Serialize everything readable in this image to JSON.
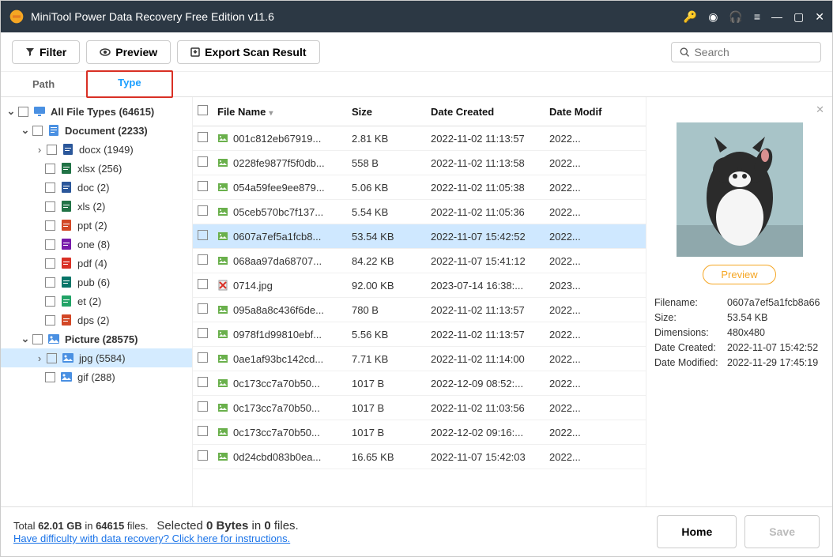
{
  "window": {
    "title": "MiniTool Power Data Recovery Free Edition v11.6"
  },
  "toolbar": {
    "filter": "Filter",
    "preview": "Preview",
    "export": "Export Scan Result",
    "searchPlaceholder": "Search"
  },
  "tabs": {
    "path": "Path",
    "type": "Type"
  },
  "tree": {
    "root": "All File Types (64615)",
    "document": "Document (2233)",
    "items": [
      "docx (1949)",
      "xlsx (256)",
      "doc (2)",
      "xls (2)",
      "ppt (2)",
      "one (8)",
      "pdf (4)",
      "pub (6)",
      "et (2)",
      "dps (2)"
    ],
    "picture": "Picture (28575)",
    "pic_items": [
      "jpg (5584)",
      "gif (288)"
    ]
  },
  "columns": {
    "name": "File Name",
    "size": "Size",
    "created": "Date Created",
    "modified": "Date Modif"
  },
  "rows": [
    {
      "name": "001c812eb67919...",
      "size": "2.81 KB",
      "created": "2022-11-02 11:13:57",
      "modified": "2022..."
    },
    {
      "name": "0228fe9877f5f0db...",
      "size": "558 B",
      "created": "2022-11-02 11:13:58",
      "modified": "2022..."
    },
    {
      "name": "054a59fee9ee879...",
      "size": "5.06 KB",
      "created": "2022-11-02 11:05:38",
      "modified": "2022..."
    },
    {
      "name": "05ceb570bc7f137...",
      "size": "5.54 KB",
      "created": "2022-11-02 11:05:36",
      "modified": "2022..."
    },
    {
      "name": "0607a7ef5a1fcb8...",
      "size": "53.54 KB",
      "created": "2022-11-07 15:42:52",
      "modified": "2022...",
      "selected": true
    },
    {
      "name": "068aa97da68707...",
      "size": "84.22 KB",
      "created": "2022-11-07 15:41:12",
      "modified": "2022..."
    },
    {
      "name": "0714.jpg",
      "size": "92.00 KB",
      "created": "2023-07-14 16:38:...",
      "modified": "2023...",
      "deleted": true
    },
    {
      "name": "095a8a8c436f6de...",
      "size": "780 B",
      "created": "2022-11-02 11:13:57",
      "modified": "2022..."
    },
    {
      "name": "0978f1d99810ebf...",
      "size": "5.56 KB",
      "created": "2022-11-02 11:13:57",
      "modified": "2022..."
    },
    {
      "name": "0ae1af93bc142cd...",
      "size": "7.71 KB",
      "created": "2022-11-02 11:14:00",
      "modified": "2022..."
    },
    {
      "name": "0c173cc7a70b50...",
      "size": "1017 B",
      "created": "2022-12-09 08:52:...",
      "modified": "2022..."
    },
    {
      "name": "0c173cc7a70b50...",
      "size": "1017 B",
      "created": "2022-11-02 11:03:56",
      "modified": "2022..."
    },
    {
      "name": "0c173cc7a70b50...",
      "size": "1017 B",
      "created": "2022-12-02 09:16:...",
      "modified": "2022..."
    },
    {
      "name": "0d24cbd083b0ea...",
      "size": "16.65 KB",
      "created": "2022-11-07 15:42:03",
      "modified": "2022..."
    }
  ],
  "preview": {
    "button": "Preview",
    "filename_k": "Filename:",
    "filename_v": "0607a7ef5a1fcb8a66",
    "size_k": "Size:",
    "size_v": "53.54 KB",
    "dim_k": "Dimensions:",
    "dim_v": "480x480",
    "created_k": "Date Created:",
    "created_v": "2022-11-07 15:42:52",
    "modified_k": "Date Modified:",
    "modified_v": "2022-11-29 17:45:19"
  },
  "footer": {
    "total_pre": "Total ",
    "total_size": "62.01 GB",
    "total_mid": " in ",
    "total_files": "64615",
    "total_suf": " files.",
    "sel_pre": "Selected ",
    "sel_bytes": "0 Bytes",
    "sel_mid": " in ",
    "sel_files": "0",
    "sel_suf": " files.",
    "help": "Have difficulty with data recovery? Click here for instructions.",
    "home": "Home",
    "save": "Save"
  }
}
